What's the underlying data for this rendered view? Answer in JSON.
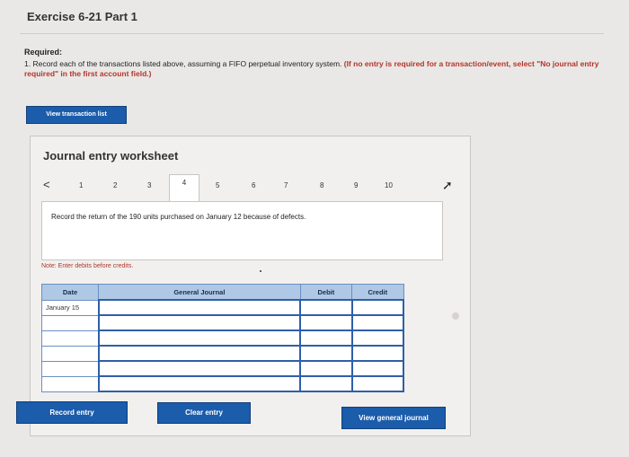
{
  "page": {
    "title": "Exercise 6-21 Part 1",
    "required_label": "Required:",
    "instruction_main": "1. Record each of the transactions listed above, assuming a FIFO perpetual inventory system. ",
    "instruction_hint": "(If no entry is required for a transaction/event, select \"No journal entry required\" in the first account field.)"
  },
  "buttons": {
    "view_transaction_list": "View transaction list",
    "record_entry": "Record entry",
    "clear_entry": "Clear entry",
    "view_general_journal": "View general journal"
  },
  "worksheet": {
    "title": "Journal entry worksheet",
    "tabs": [
      "1",
      "2",
      "3",
      "4",
      "5",
      "6",
      "7",
      "8",
      "9",
      "10"
    ],
    "active_tab": "4",
    "prev_arrow": "<",
    "prompt": "Record the return of the 190 units purchased on January 12 because of defects.",
    "note": "Note: Enter debits before credits."
  },
  "journal": {
    "headers": {
      "date": "Date",
      "account": "General Journal",
      "debit": "Debit",
      "credit": "Credit"
    },
    "rows": [
      {
        "date": "January 15",
        "account": "",
        "debit": "",
        "credit": ""
      },
      {
        "date": "",
        "account": "",
        "debit": "",
        "credit": ""
      },
      {
        "date": "",
        "account": "",
        "debit": "",
        "credit": ""
      },
      {
        "date": "",
        "account": "",
        "debit": "",
        "credit": ""
      },
      {
        "date": "",
        "account": "",
        "debit": "",
        "credit": ""
      },
      {
        "date": "",
        "account": "",
        "debit": "",
        "credit": ""
      }
    ]
  },
  "colors": {
    "accent": "#1b5cab",
    "note_red": "#b5342b",
    "header_blue": "#aec8e6"
  }
}
